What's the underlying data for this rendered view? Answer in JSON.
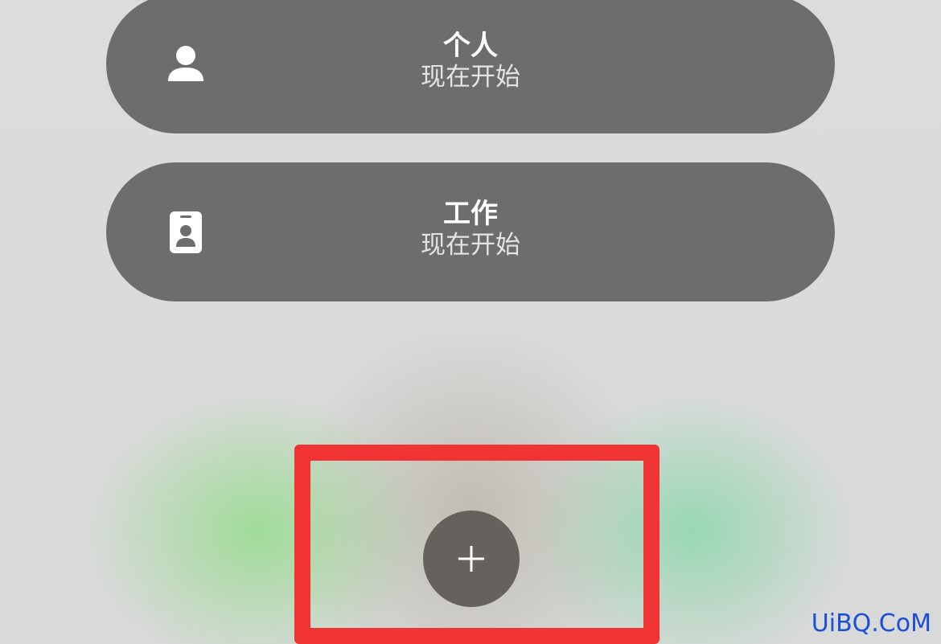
{
  "focus_options": [
    {
      "title": "个人",
      "subtitle": "现在开始",
      "icon": "person-icon"
    },
    {
      "title": "工作",
      "subtitle": "现在开始",
      "icon": "id-badge-icon"
    }
  ],
  "add_button": {
    "icon": "plus-icon"
  },
  "highlight_color": "#f03434",
  "watermark": "UiBQ.CoM"
}
